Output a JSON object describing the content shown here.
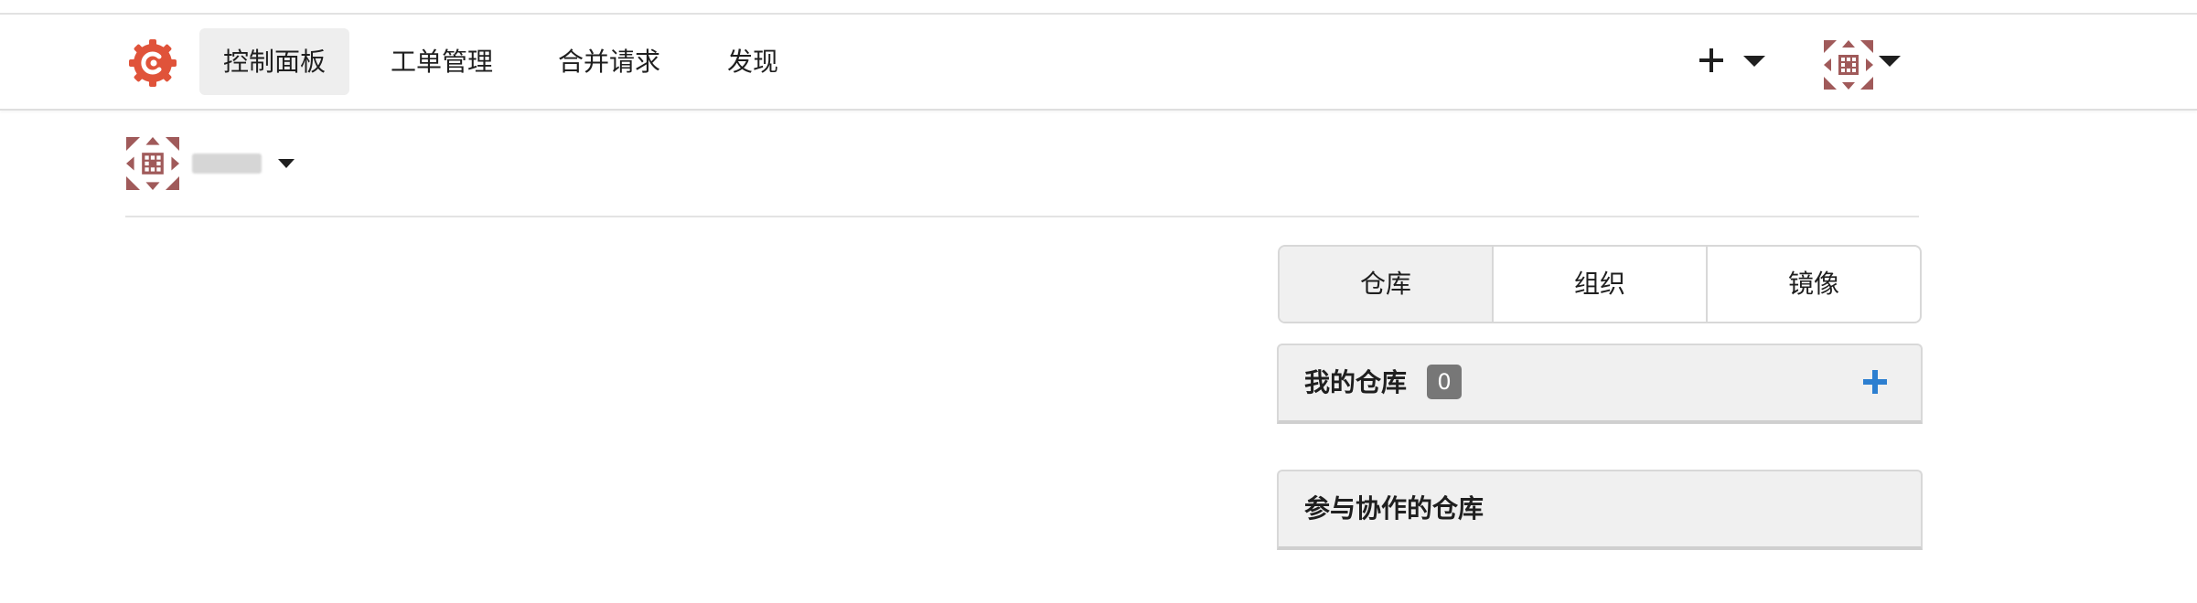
{
  "colors": {
    "brand": "#e0533a",
    "accent_blue": "#2d7fd0",
    "badge_bg": "#777777",
    "avatar": "#a05a5a"
  },
  "header": {
    "logo_icon": "gitea-logo-icon",
    "nav": [
      {
        "label": "控制面板",
        "active": true
      },
      {
        "label": "工单管理",
        "active": false
      },
      {
        "label": "合并请求",
        "active": false
      },
      {
        "label": "发现",
        "active": false
      }
    ],
    "create_icon": "plus-icon",
    "user_icon": "avatar"
  },
  "context": {
    "user_icon": "avatar",
    "user_name": ""
  },
  "sidebar": {
    "tabs": [
      {
        "label": "仓库",
        "active": true
      },
      {
        "label": "组织",
        "active": false
      },
      {
        "label": "镜像",
        "active": false
      }
    ],
    "my_repos": {
      "title": "我的仓库",
      "count": "0",
      "add_icon": "plus-icon"
    },
    "collab_repos": {
      "title": "参与协作的仓库"
    }
  }
}
